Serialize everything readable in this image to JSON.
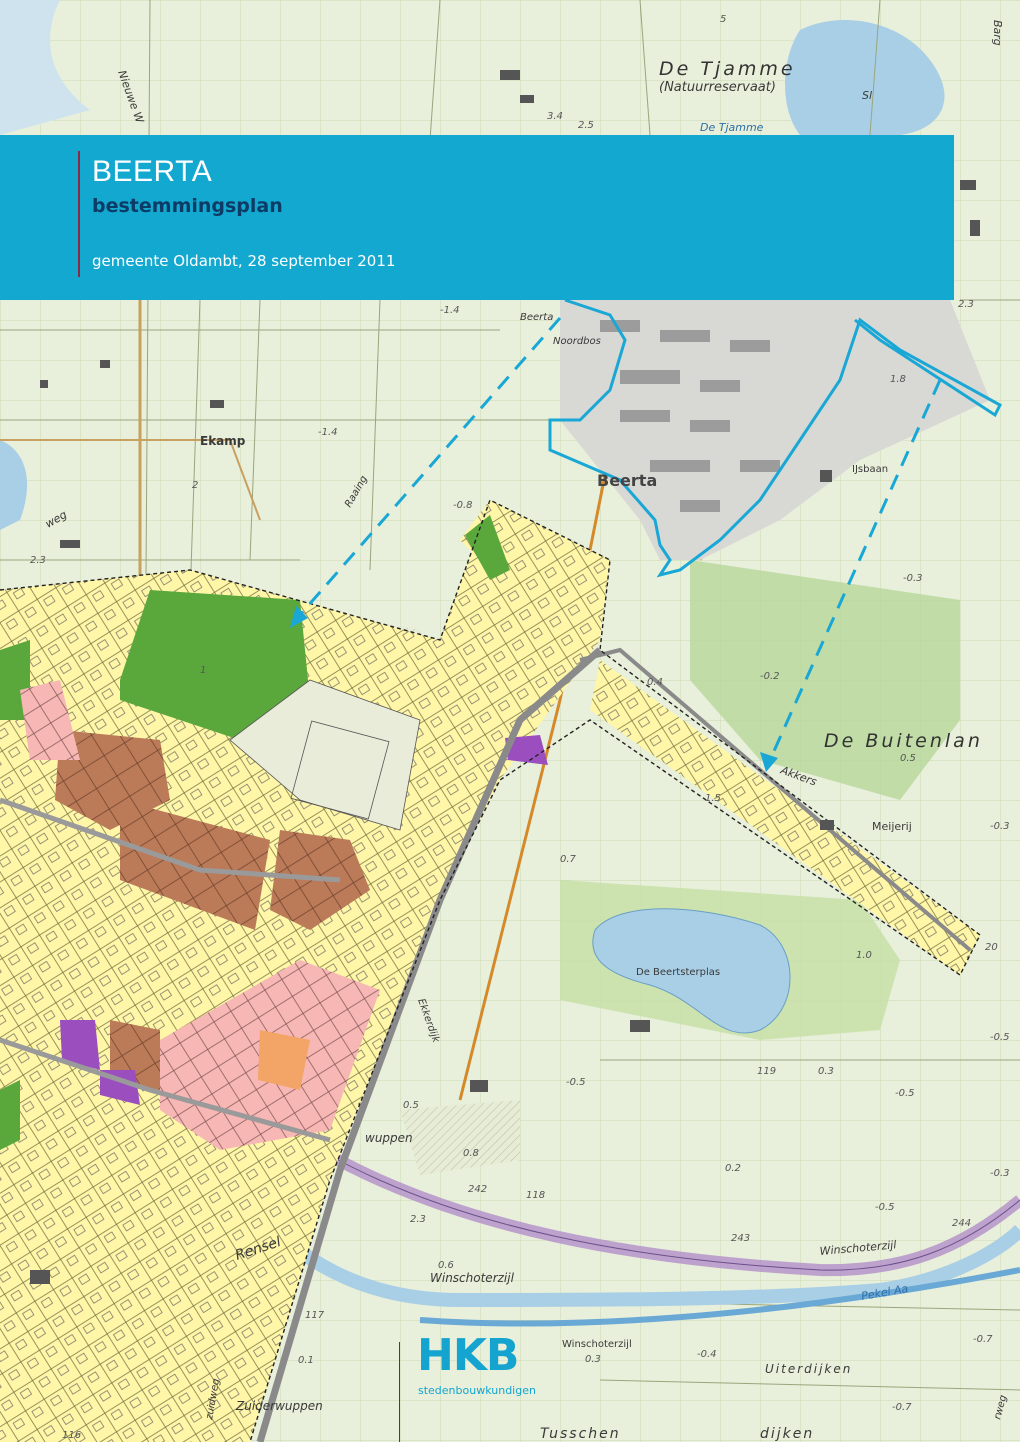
{
  "document": {
    "title": "BEERTA",
    "subtitle": "bestemmingsplan",
    "meta": "gemeente Oldambt, 28 september 2011"
  },
  "logo": {
    "wordmark": "HKB",
    "tagline": "stedenbouwkundigen"
  },
  "map": {
    "place_names": {
      "de_tjamme": "De Tjamme",
      "natuurreservaat": "(Natuurreservaat)",
      "de_tjamme_water": "De Tjamme",
      "beerta": "Beerta",
      "beerta_small": "Beerta",
      "noordbos": "Noordbos",
      "ekamp": "Ekamp",
      "ijsbaan": "IJsbaan",
      "raaing": "Raaing",
      "weg": "weg",
      "de_buitenlanden": "De Buitenlan",
      "akkers": "Akkers",
      "meijerij": "Meijerij",
      "de_beertsterplas": "De Beertsterplas",
      "winschoterzijl_road": "Winschoterzijl",
      "winschoterzijl_canal": "Winschoterzijl",
      "winschoterzijl_place": "Winschoterzijl",
      "rensel": "Rensel",
      "pekel_aa": "Pekel Aa",
      "uiterdijken": "Uiterdijken",
      "zuiderwuppen": "Zuiderwuppen",
      "wuppen": "wuppen",
      "dijken": "dijken",
      "tusschen": "Tusschen",
      "sl": "Sl",
      "barg": "Barg",
      "ekkerdijk": "Ekkerdijk",
      "nieuwe_weg": "Nieuwe W",
      "zuidweg": "zuidweg",
      "zandweg": "rweg"
    },
    "heights": [
      "3.4",
      "2.5",
      "-1.4",
      "2.3",
      "1.8",
      "-1.4",
      "2",
      "2.3",
      "-0.8",
      "-0.3",
      "0.4",
      "-0.2",
      "0.5",
      "-0.3",
      "0.7",
      "1.0",
      "-0.5",
      "119",
      "0.3",
      "-0.5",
      "0.5",
      "-0.5",
      "0.8",
      "0.2",
      "-0.3",
      "242",
      "118",
      "-0.5",
      "244",
      "243",
      "2.3",
      "0.6",
      "117",
      "-0.7",
      "0.1",
      "-0.4",
      "0.3",
      "-0.7",
      "116",
      "20",
      "1.5",
      "5",
      "1"
    ],
    "colors": {
      "water": "#a9cfe6",
      "grass": "#dde8c4",
      "residential": "#fff6a8",
      "green_zone": "#5aa83c",
      "society": "#bb7a58",
      "mixed": "#f7b7b4",
      "business": "#9b4fbf",
      "boundary": "#19a7d6",
      "banner": "#13a8cf"
    }
  }
}
